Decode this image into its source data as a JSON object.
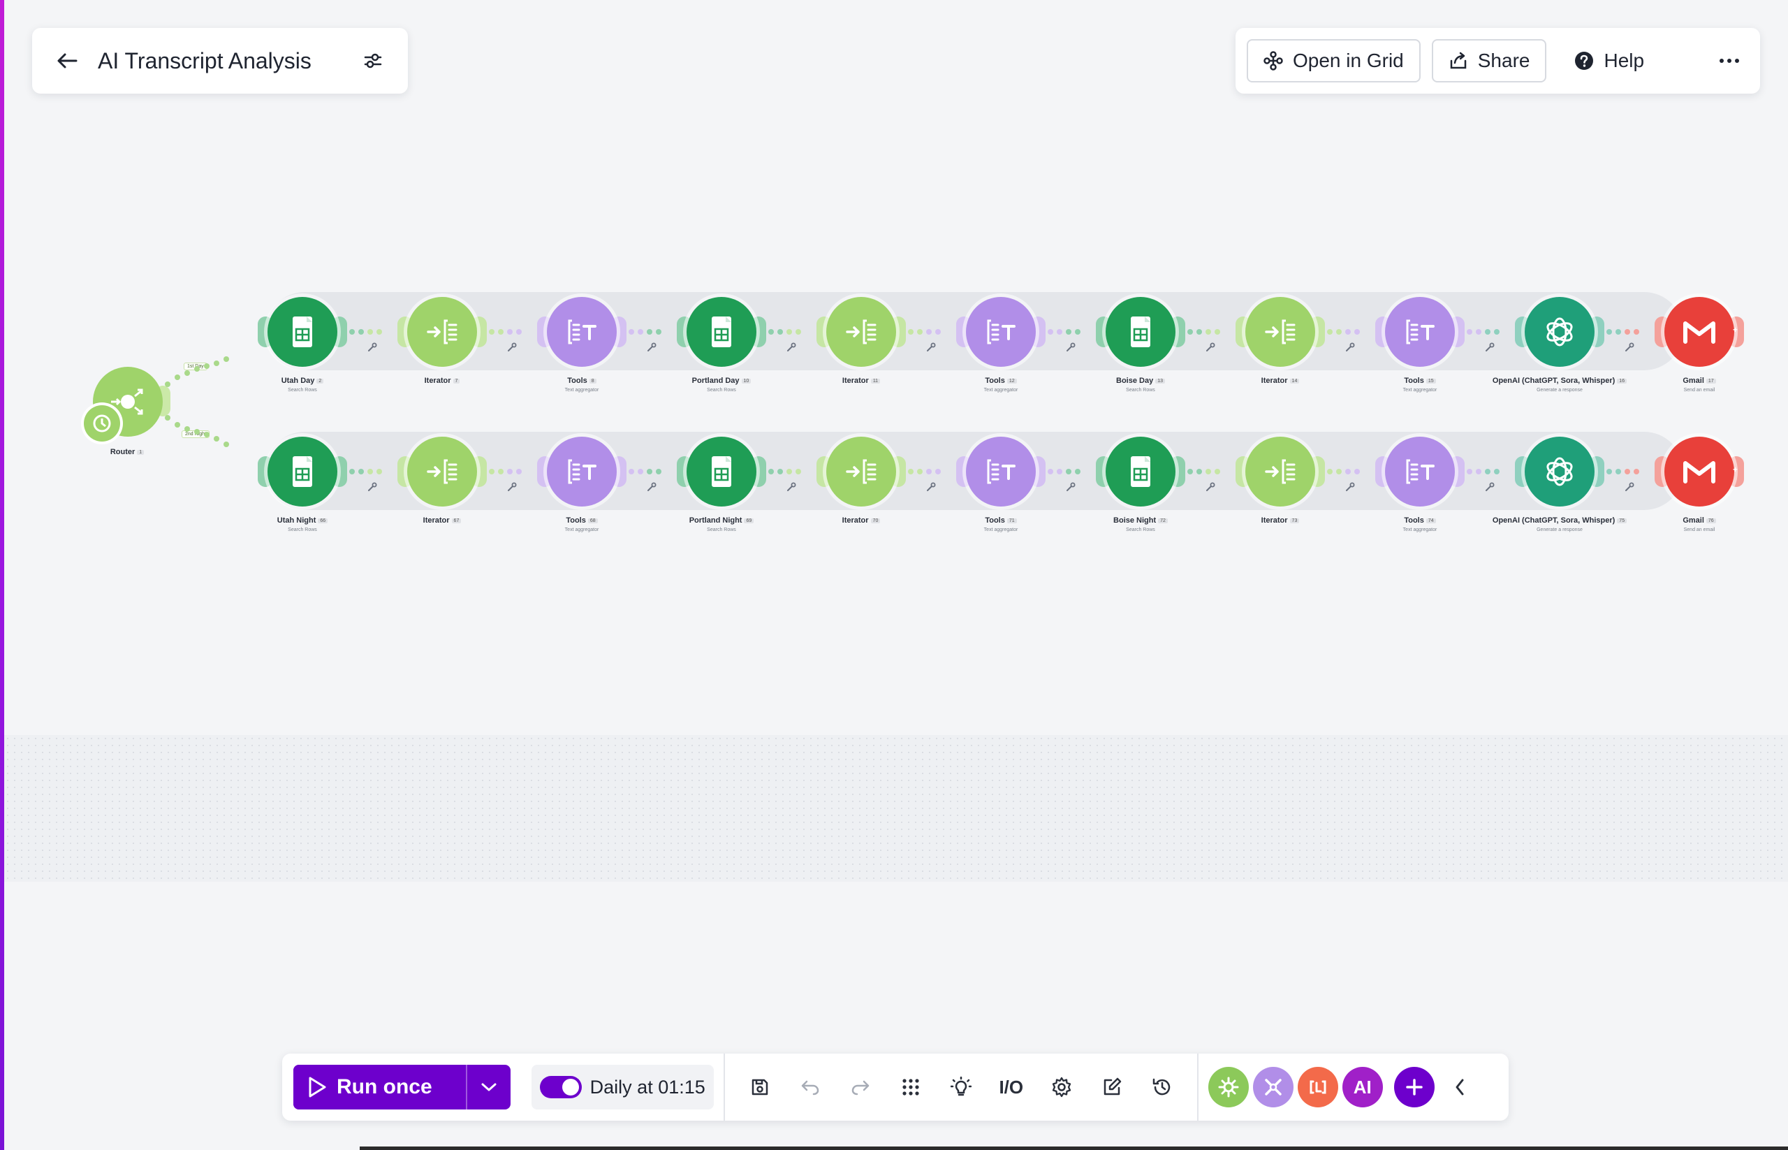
{
  "header": {
    "scenario_title": "AI Transcript Analysis",
    "open_in_grid_label": "Open in Grid",
    "share_label": "Share",
    "help_label": "Help"
  },
  "router": {
    "label": "Router",
    "number": "1",
    "route_day": "Day",
    "route_night": "Night",
    "tag_day": "1st",
    "tag_night": "2nd"
  },
  "day_row": [
    {
      "label": "Utah Day",
      "number": "2",
      "sub": "Search Rows"
    },
    {
      "label": "Iterator",
      "number": "7",
      "sub": ""
    },
    {
      "label": "Tools",
      "number": "8",
      "sub": "Text aggregator"
    },
    {
      "label": "Portland Day",
      "number": "10",
      "sub": "Search Rows"
    },
    {
      "label": "Iterator",
      "number": "11",
      "sub": ""
    },
    {
      "label": "Tools",
      "number": "12",
      "sub": "Text aggregator"
    },
    {
      "label": "Boise Day",
      "number": "13",
      "sub": "Search Rows"
    },
    {
      "label": "Iterator",
      "number": "14",
      "sub": ""
    },
    {
      "label": "Tools",
      "number": "15",
      "sub": "Text aggregator"
    },
    {
      "label": "OpenAI (ChatGPT, Sora, Whisper)",
      "number": "16",
      "sub": "Generate a response"
    },
    {
      "label": "Gmail",
      "number": "17",
      "sub": "Send an email"
    }
  ],
  "night_row": [
    {
      "label": "Utah Night",
      "number": "66",
      "sub": "Search Rows"
    },
    {
      "label": "Iterator",
      "number": "67",
      "sub": ""
    },
    {
      "label": "Tools",
      "number": "68",
      "sub": "Text aggregator"
    },
    {
      "label": "Portland Night",
      "number": "69",
      "sub": "Search Rows"
    },
    {
      "label": "Iterator",
      "number": "70",
      "sub": ""
    },
    {
      "label": "Tools",
      "number": "71",
      "sub": "Text aggregator"
    },
    {
      "label": "Boise Night",
      "number": "72",
      "sub": "Search Rows"
    },
    {
      "label": "Iterator",
      "number": "73",
      "sub": ""
    },
    {
      "label": "Tools",
      "number": "74",
      "sub": "Text aggregator"
    },
    {
      "label": "OpenAI (ChatGPT, Sora, Whisper)",
      "number": "75",
      "sub": "Generate a response"
    },
    {
      "label": "Gmail",
      "number": "76",
      "sub": "Send an email"
    }
  ],
  "toolbar": {
    "run_once_label": "Run once",
    "schedule_label": "Daily at 01:15",
    "ai_badge": "AI",
    "io_label": "I/O"
  },
  "icons": {
    "sheets": "google-sheets-icon",
    "iterator": "iterator-icon",
    "tools": "text-aggregator-icon",
    "openai": "openai-icon",
    "gmail": "gmail-icon"
  },
  "colors": {
    "brand_purple": "#6d00cc",
    "sheets_green": "#1f9d55",
    "iterator_green": "#9fd36a",
    "tools_purple": "#b18ee8",
    "openai_green": "#1f9f79",
    "gmail_red": "#e8403a"
  }
}
